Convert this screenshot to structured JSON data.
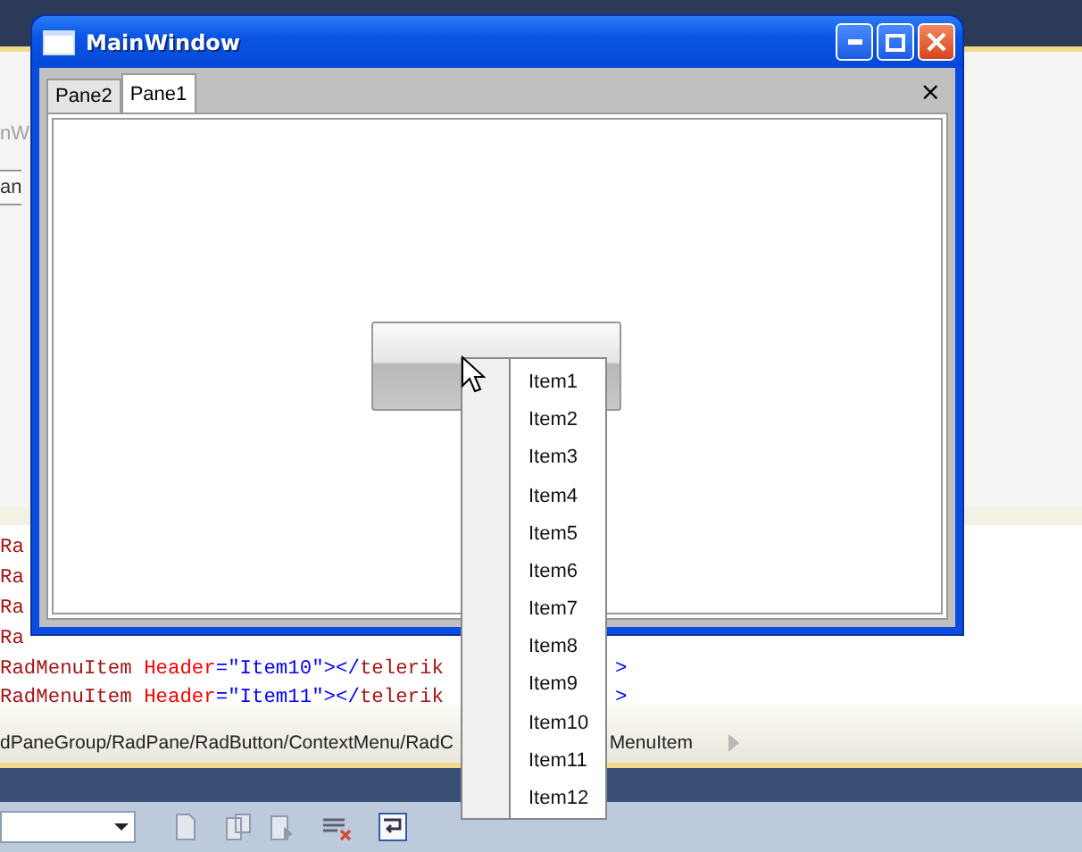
{
  "ide": {
    "faded_texts": [
      "nW",
      "an"
    ],
    "code_lines": [
      [
        {
          "text": "Ra",
          "kind": "element"
        }
      ],
      [
        {
          "text": "Ra",
          "kind": "element"
        }
      ],
      [
        {
          "text": "Ra",
          "kind": "element"
        }
      ],
      [
        {
          "text": "Ra",
          "kind": "element"
        }
      ],
      [
        {
          "text": "RadMenuItem",
          "kind": "element"
        },
        {
          "text": " Header",
          "kind": "attribute"
        },
        {
          "text": "=\"Item10\"></",
          "kind": "value"
        },
        {
          "text": "telerik",
          "kind": "element"
        }
      ],
      [
        {
          "text": "RadMenuItem",
          "kind": "element"
        },
        {
          "text": " Header",
          "kind": "attribute"
        },
        {
          "text": "=\"Item11\"></",
          "kind": "value"
        },
        {
          "text": "telerik",
          "kind": "element"
        }
      ]
    ],
    "code_tails": [
      ">",
      ">"
    ],
    "breadcrumb": [
      "dPaneGroup/RadPane/RadButton/ContextMenu/RadC",
      "MenuItem"
    ]
  },
  "window": {
    "title": "MainWindow",
    "tabs": [
      {
        "label": "Pane2",
        "selected": false
      },
      {
        "label": "Pane1",
        "selected": true
      }
    ],
    "close_glyph": "×"
  },
  "context_menu": {
    "items": [
      "Item1",
      "Item2",
      "Item3",
      "Item4",
      "Item5",
      "Item6",
      "Item7",
      "Item8",
      "Item9",
      "Item10",
      "Item11",
      "Item12"
    ]
  }
}
